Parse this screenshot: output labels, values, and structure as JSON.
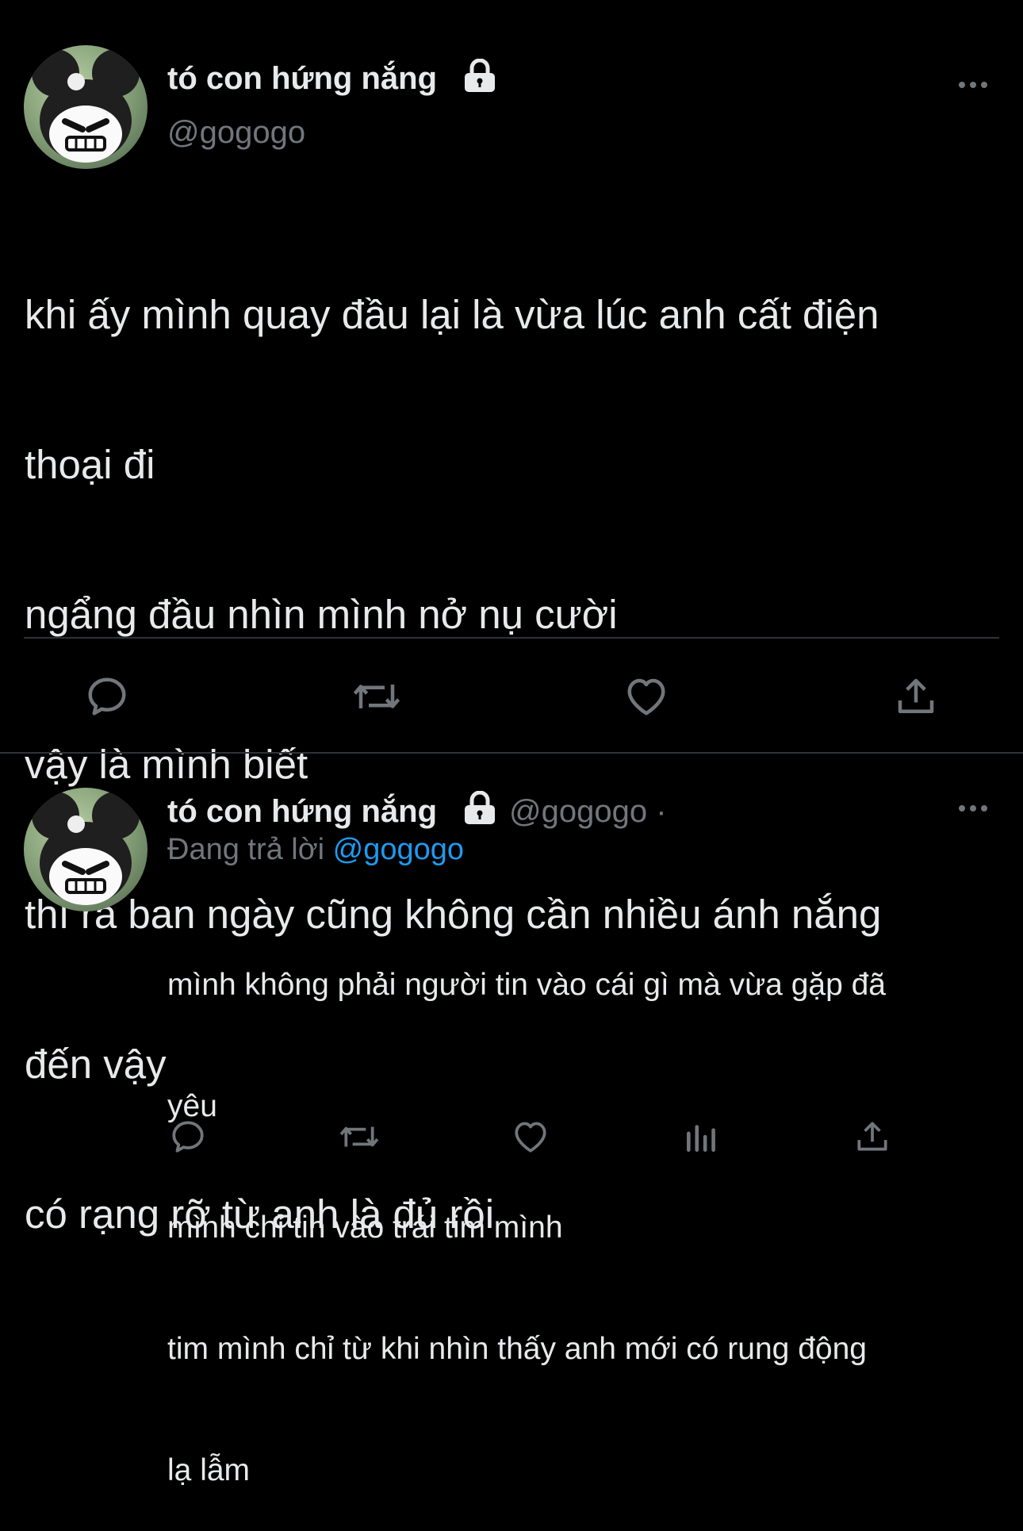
{
  "main_tweet": {
    "display_name": "tó con hứng nắng",
    "handle": "@gogogo",
    "lines": [
      "khi ấy mình quay đầu lại là vừa lúc anh cất điện",
      "thoại đi",
      "ngẩng đầu nhìn mình nở nụ cười",
      "vậy là mình biết",
      "thì ra ban ngày cũng không cần nhiều ánh nắng",
      "đến vậy",
      "có rạng rỡ từ anh là đủ rồi"
    ]
  },
  "reply_tweet": {
    "display_name": "tó con hứng nắng",
    "handle": "@gogogo",
    "separator": "·",
    "replying_prefix": "Đang trả lời",
    "replying_to": "@gogogo",
    "lines": [
      "mình không phải người tin vào cái gì mà vừa gặp đã",
      "yêu",
      "mình chỉ tin vào trái tim mình",
      "tim mình chỉ từ khi nhìn thấy anh mới có rung động",
      "lạ lẫm"
    ]
  },
  "colors": {
    "background": "#000000",
    "text": "#e7e9ea",
    "secondary": "#71767b",
    "accent": "#1d9bf0"
  },
  "icons": [
    "lock-icon",
    "more-icon",
    "reply-icon",
    "retweet-icon",
    "like-icon",
    "share-icon",
    "analytics-icon"
  ]
}
